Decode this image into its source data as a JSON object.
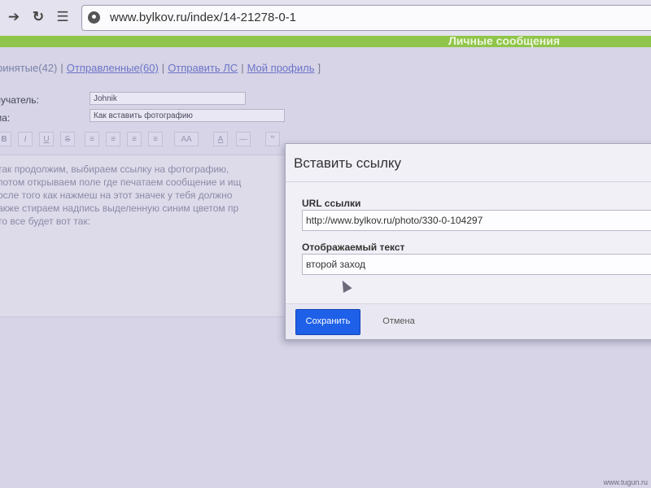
{
  "browser": {
    "url": "www.bylkov.ru/index/14-21278-0-1",
    "icons": [
      "forward-icon",
      "reload-icon",
      "apps-icon",
      "site-info-icon"
    ]
  },
  "header": {
    "title": "Личные сообщения",
    "accent_color": "#8fc54a"
  },
  "nav": {
    "received": "ринятые(42)",
    "sent": "Отправленные(60)",
    "send": "Отправить ЛС",
    "profile": "Мой профиль",
    "separator": "|",
    "close_bracket": "]"
  },
  "form": {
    "recipient_label": "лучатель:",
    "recipient_value": "Johnik",
    "subject_label": "ма:",
    "subject_value": "Как вставить фотографию"
  },
  "toolbar": {
    "bold": "B",
    "italic": "I",
    "underline": "U",
    "strike": "S",
    "font_size": "AA",
    "color": "A",
    "quote": "“"
  },
  "editor": {
    "lines": [
      "так продолжим, выбираем ссылку на фотографию,",
      "потом открываем поле где печатаем сообщение и ищ",
      "осле того как нажмеш на этот значек у тебя должно",
      "акже стираем надпись выделенную синим цветом пр",
      "то все будет вот так:"
    ]
  },
  "modal": {
    "title": "Вставить ссылку",
    "url_label": "URL ссылки",
    "url_value": "http://www.bylkov.ru/photo/330-0-104297",
    "text_label": "Отображаемый текст",
    "text_value": "второй заход",
    "save_label": "Сохранить",
    "cancel_label": "Отмена",
    "save_color": "#1e60e8"
  },
  "watermark": "www.tugun.ru"
}
